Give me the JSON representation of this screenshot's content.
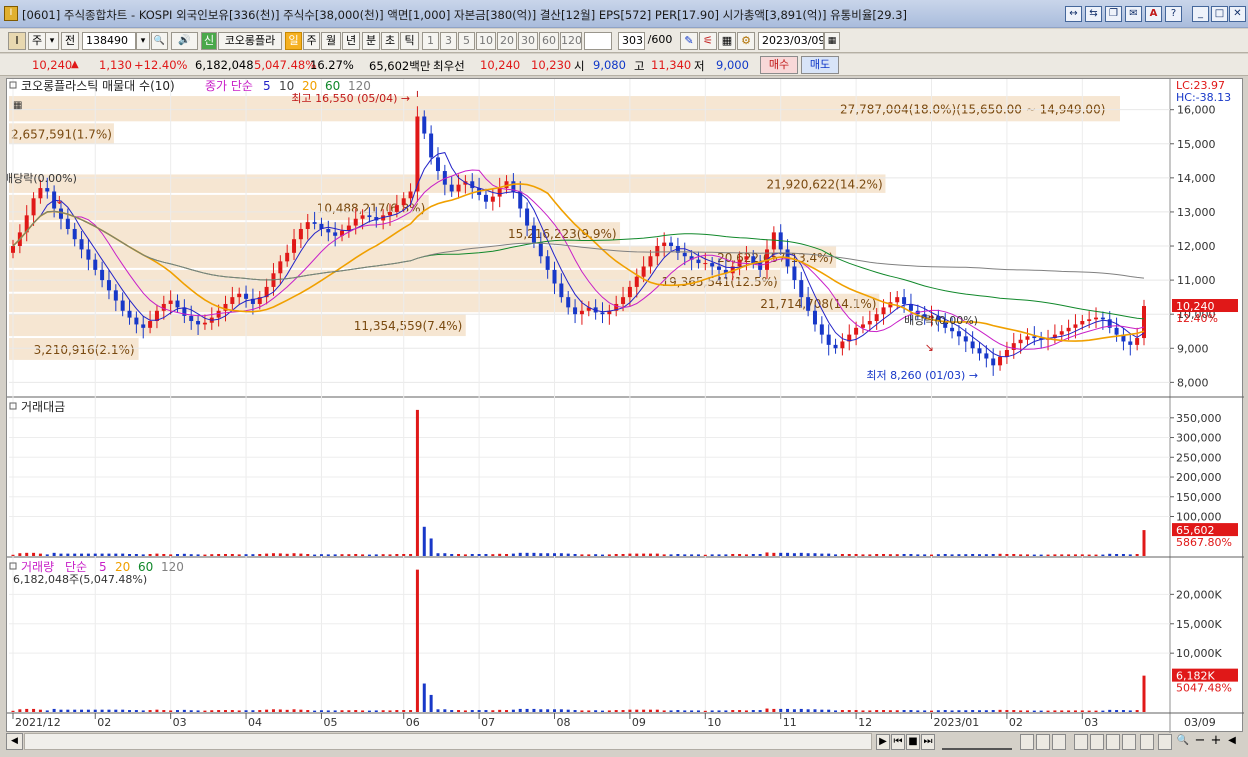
{
  "window": {
    "title": "[0601] 주식종합차트 - KOSPI 외국인보유[336(천)] 주식수[38,000(천)] 액면[1,000] 자본금[380(억)] 결산[12월] EPS[572] PER[17.90] 시가총액[3,891(억)] 유통비율[29.3]",
    "icon_label": "I",
    "buttons": [
      "↔",
      "⇆",
      "❐",
      "✉",
      "A",
      "?",
      "_",
      "□",
      "✕"
    ]
  },
  "toolbar": {
    "mode": "주",
    "mode_dd": "▾",
    "prev": "전",
    "code": "138490",
    "code_dd": "▾",
    "search": "🔍",
    "speaker": "🔊",
    "new_badge": "신",
    "name": "코오롱플라",
    "periods": [
      "일",
      "주",
      "월",
      "년",
      "분",
      "초",
      "틱"
    ],
    "intervals": [
      "1",
      "3",
      "5",
      "10",
      "20",
      "30",
      "60",
      "120"
    ],
    "count": "303",
    "count_total": "/600",
    "tool_icons": [
      "✎",
      "⚟",
      "▦",
      "⚙"
    ],
    "date": "2023/03/09",
    "calendar": "▦"
  },
  "quote": {
    "price": "10,240",
    "arrow": "▲",
    "change": "1,130",
    "change_pct": "+12.40%",
    "volume": "6,182,048",
    "volume_ratio": "5,047.48%",
    "turnover": "16.27%",
    "amount": "65,602백만",
    "best_label": "최우선",
    "ask": "10,240",
    "bid": "10,230",
    "open_label": "시",
    "open": "9,080",
    "high_label": "고",
    "high": "11,340",
    "low_label": "저",
    "low": "9,000",
    "buy": "매수",
    "sell": "매도"
  },
  "chart_data": [
    {
      "type": "candlestick",
      "title": "코오롱플라스틱 매물대 수(10)",
      "legend_prefix": "종가 단순",
      "ma_periods": [
        "5",
        "10",
        "20",
        "60",
        "120"
      ],
      "colors": {
        "up": "#e01818",
        "down": "#1838c8",
        "ma5": "#2323c8",
        "ma10": "#c820c8",
        "ma20": "#f0a000",
        "ma60": "#10882a",
        "ma120": "#808080"
      },
      "yticks": [
        16000,
        15000,
        14000,
        13000,
        12000,
        11000,
        10000,
        9000,
        8000
      ],
      "ytick_labels": [
        "16,000",
        "15,000",
        "14,000",
        "13,000",
        "12,000",
        "11,000",
        "10,000",
        "9,000",
        "8,000"
      ],
      "ylim": [
        7600,
        16900
      ],
      "lc_label": "LC:23.97",
      "hc_label": "HC:-38.13",
      "last_price_label": "10,240",
      "last_pct_label": "12.40%",
      "high_note": "최고 16,550 (05/04) →",
      "low_note": "최저 8,260 (01/03) →",
      "dividend_labels": [
        "배당락(0.00%)",
        "배당락(0.00%)"
      ],
      "volume_profile": [
        {
          "low": 15600,
          "high": 16400,
          "pct": 18.0,
          "label": "27,787,004(18.0%)(15,650.00 ~ 14,949.00)"
        },
        {
          "low": 14949,
          "high": 15600,
          "pct": 1.7,
          "label": "2,657,591(1.7%)"
        },
        {
          "low": 13500,
          "high": 14100,
          "pct": 14.2,
          "label": "21,920,622(14.2%)"
        },
        {
          "low": 12700,
          "high": 13500,
          "pct": 6.8,
          "label": "10,488,217(6.8%)"
        },
        {
          "low": 12000,
          "high": 12700,
          "pct": 9.9,
          "label": "15,216,223(9.9%)"
        },
        {
          "low": 11300,
          "high": 12000,
          "pct": 13.4,
          "label": "20,622,657(13.4%)"
        },
        {
          "low": 10600,
          "high": 11300,
          "pct": 12.5,
          "label": "19,365,541(12.5%)"
        },
        {
          "low": 10000,
          "high": 10600,
          "pct": 14.1,
          "label": "21,714,708(14.1%)"
        },
        {
          "low": 9300,
          "high": 10000,
          "pct": 7.4,
          "label": "11,354,559(7.4%)"
        },
        {
          "low": 8600,
          "high": 9300,
          "pct": 2.1,
          "label": "3,210,916(2.1%)"
        }
      ],
      "x_labels": [
        "2021/12",
        "02",
        "03",
        "04",
        "05",
        "06",
        "07",
        "08",
        "09",
        "10",
        "11",
        "12",
        "2023/01",
        "02",
        "03",
        "03/09"
      ],
      "close": [
        12000,
        12400,
        12900,
        13400,
        13700,
        13600,
        13100,
        12800,
        12500,
        12200,
        11900,
        11600,
        11300,
        11000,
        10700,
        10400,
        10100,
        9900,
        9700,
        9600,
        9800,
        10100,
        10300,
        10400,
        10200,
        9950,
        9800,
        9700,
        9750,
        9900,
        10100,
        10300,
        10500,
        10600,
        10450,
        10300,
        10500,
        10800,
        11200,
        11550,
        11800,
        12200,
        12500,
        12700,
        12650,
        12500,
        12400,
        12300,
        12450,
        12600,
        12800,
        12900,
        12850,
        12750,
        12900,
        13000,
        13200,
        13400,
        13600,
        15800,
        15300,
        14600,
        14200,
        13800,
        13600,
        13800,
        13900,
        13700,
        13500,
        13300,
        13450,
        13700,
        13900,
        13600,
        13100,
        12600,
        12100,
        11700,
        11300,
        10900,
        10500,
        10200,
        10000,
        10100,
        10200,
        10050,
        10000,
        10100,
        10300,
        10500,
        10800,
        11100,
        11400,
        11700,
        12000,
        12100,
        12000,
        11800,
        11700,
        11600,
        11500,
        11500,
        11400,
        11300,
        11200,
        11400,
        11600,
        11700,
        11500,
        11300,
        11900,
        12400,
        11900,
        11400,
        11000,
        10500,
        10100,
        9700,
        9400,
        9100,
        9000,
        9200,
        9400,
        9600,
        9700,
        9800,
        10000,
        10200,
        10350,
        10500,
        10300,
        10100,
        10000,
        9900,
        9950,
        9800,
        9600,
        9500,
        9350,
        9200,
        9000,
        8850,
        8700,
        8500,
        8750,
        8950,
        9150,
        9250,
        9350,
        9300,
        9250,
        9300,
        9400,
        9500,
        9600,
        9700,
        9800,
        9850,
        9900,
        9850,
        9600,
        9400,
        9200,
        9100,
        9300,
        10240
      ],
      "sub_panels": [
        {
          "title": "거래대금",
          "ytick_labels": [
            "350,000",
            "300,000",
            "250,000",
            "200,000",
            "150,000",
            "100,000"
          ],
          "yticks": [
            350000,
            300000,
            250000,
            200000,
            150000,
            100000
          ],
          "ylim": [
            0,
            390000
          ],
          "last_value_label": "65,602",
          "last_pct_label": "5867.80%",
          "spike_value": 370000,
          "second_value": 80000
        },
        {
          "title": "거래량",
          "legend_prefix": "단순",
          "ma_periods": [
            "5",
            "20",
            "60",
            "120"
          ],
          "subtitle": "6,182,048주(5,047.48%)",
          "ytick_labels": [
            "20,000K",
            "15,000K",
            "10,000K"
          ],
          "yticks": [
            20000,
            15000,
            10000
          ],
          "ylim": [
            0,
            25500
          ],
          "last_value_label": "6,182K",
          "last_pct_label": "5047.48%",
          "spike_value": 24200,
          "last_value": 6182
        }
      ]
    }
  ],
  "footer": {
    "scroll_left": "◀",
    "scroll_right": "▶",
    "nav_buttons": [
      "▶",
      "⏮",
      "■",
      "⏭"
    ],
    "zoom": [
      "−",
      "+",
      "◀"
    ]
  }
}
